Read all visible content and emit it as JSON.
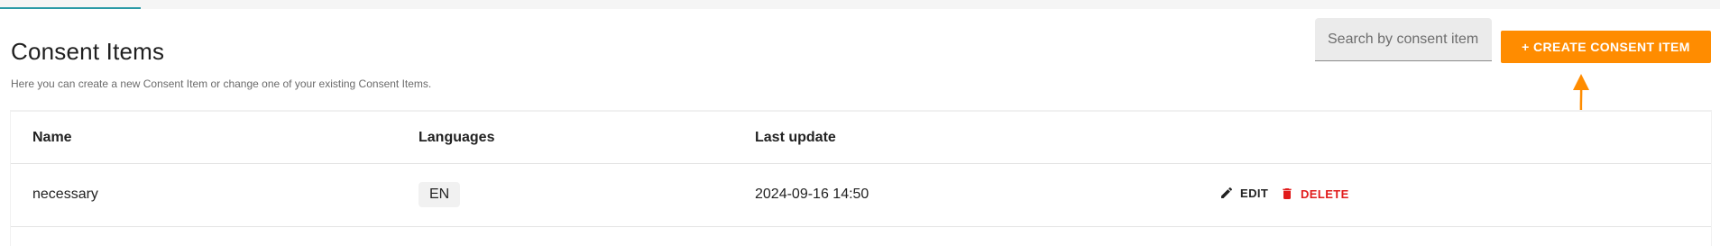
{
  "header": {
    "title": "Consent Items",
    "subtitle": "Here you can create a new Consent Item or change one of your existing Consent Items."
  },
  "search": {
    "placeholder": "Search by consent item",
    "value": ""
  },
  "create_button": {
    "label": "+ CREATE CONSENT ITEM"
  },
  "table": {
    "columns": [
      "Name",
      "Languages",
      "Last update"
    ],
    "rows": [
      {
        "name": "necessary",
        "languages": "EN",
        "last_update": "2024-09-16 14:50",
        "edit_label": "EDIT",
        "delete_label": "DELETE"
      }
    ]
  },
  "icons": {
    "edit": "pencil-icon",
    "delete": "trash-icon",
    "annotation": "arrow-up-icon"
  },
  "colors": {
    "accent": "#ff8c00",
    "tab_indicator": "#2a9aa6",
    "delete": "#e11b1b"
  }
}
